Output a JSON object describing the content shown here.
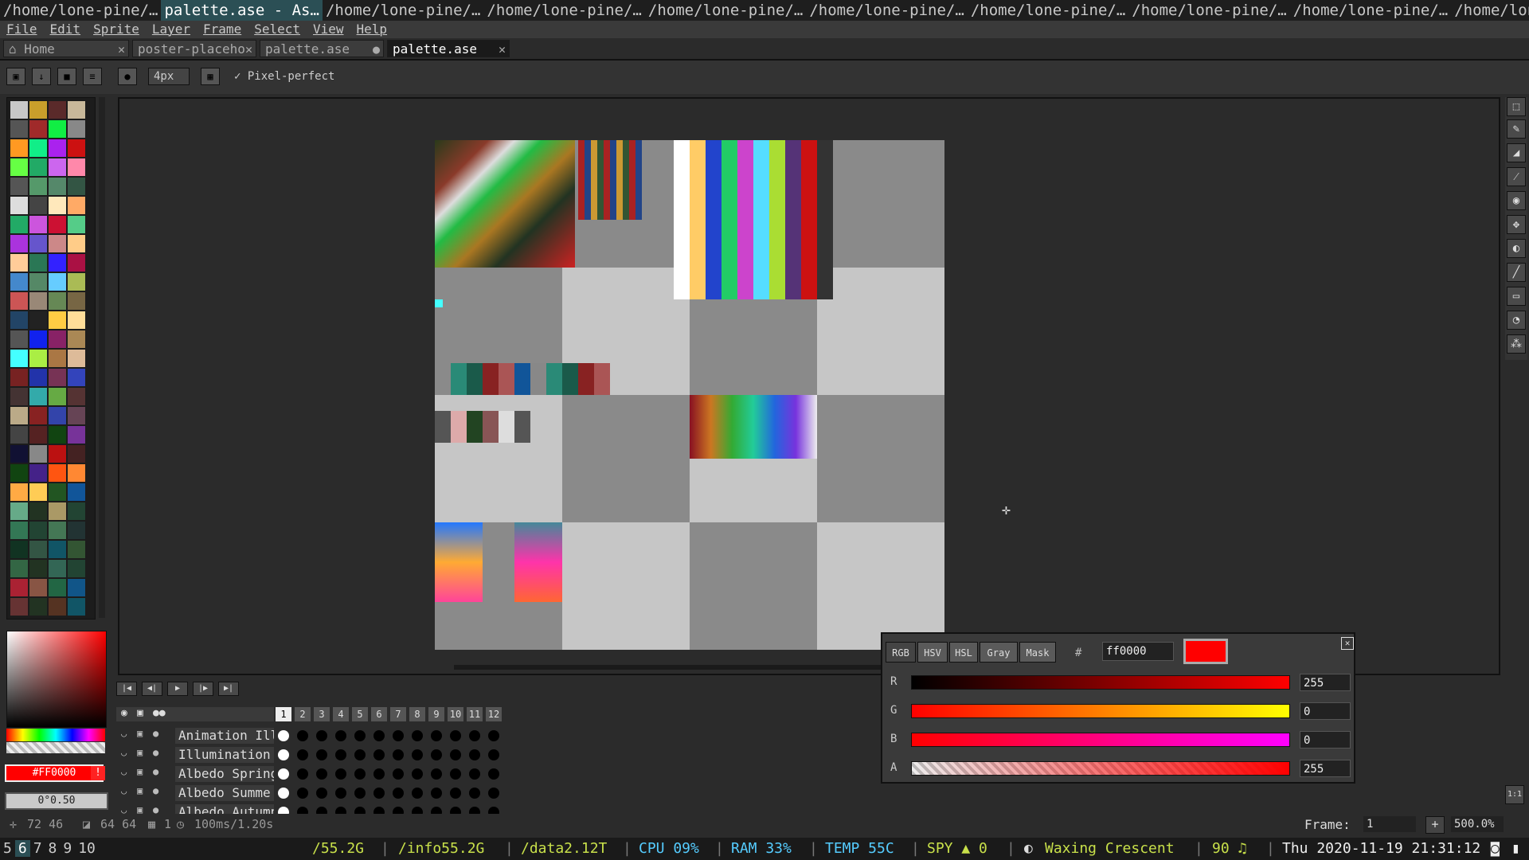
{
  "window_titles": [
    {
      "label": "/home/lone-pine/…",
      "active": false
    },
    {
      "label": "palette.ase - As…",
      "active": true
    },
    {
      "label": "/home/lone-pine/…",
      "active": false
    },
    {
      "label": "/home/lone-pine/…",
      "active": false
    },
    {
      "label": "/home/lone-pine/…",
      "active": false
    },
    {
      "label": "/home/lone-pine/…",
      "active": false
    },
    {
      "label": "/home/lone-pine/…",
      "active": false
    },
    {
      "label": "/home/lone-pine/…",
      "active": false
    },
    {
      "label": "/home/lone-pine/…",
      "active": false
    },
    {
      "label": "/home/lone-pine/…",
      "active": false
    }
  ],
  "menu": [
    "File",
    "Edit",
    "Sprite",
    "Layer",
    "Frame",
    "Select",
    "View",
    "Help"
  ],
  "tabs": [
    {
      "label": "Home",
      "close": "✕",
      "active": false
    },
    {
      "label": "poster-placeho",
      "close": "✕",
      "active": false
    },
    {
      "label": "palette.ase",
      "close": "●",
      "active": false
    },
    {
      "label": "palette.ase",
      "close": "✕",
      "active": true
    }
  ],
  "toolbar": {
    "brush_size": "4px",
    "pixel_perfect": "Pixel-perfect"
  },
  "palette_colors": [
    "#c8c8c8",
    "#c99f2b",
    "#5a2a2a",
    "#c8b89a",
    "#555555",
    "#a02a2a",
    "#11ee44",
    "#888888",
    "#ff9922",
    "#11ee88",
    "#aa22ee",
    "#cc1111",
    "#66ff44",
    "#22aa66",
    "#cc66ee",
    "#ff88aa",
    "#555555",
    "#55996a",
    "#55886a",
    "#335544",
    "#dddddd",
    "#444444",
    "#ffe8bb",
    "#ffaa66",
    "#22aa66",
    "#cc55dd",
    "#cc1133",
    "#55cc88",
    "#aa33dd",
    "#6655cc",
    "#cc8888",
    "#ffcc88",
    "#ffcc99",
    "#2a7755",
    "#3322ff",
    "#aa1144",
    "#4488cc",
    "#558866",
    "#66ccff",
    "#aabb55",
    "#cc5555",
    "#998877",
    "#668855",
    "#776644",
    "#224466",
    "#222222",
    "#ffcc44",
    "#ffdd99",
    "#555555",
    "#1122ee",
    "#882266",
    "#aa8855",
    "#44ffff",
    "#aaee44",
    "#aa7744",
    "#ddbb99",
    "#772222",
    "#2233aa",
    "#773355",
    "#3344bb",
    "#443333",
    "#33aaaa",
    "#66aa44",
    "#553333",
    "#bbaa88",
    "#882222",
    "#3344aa",
    "#664455",
    "#444444",
    "#552222",
    "#114411",
    "#773399",
    "#111133",
    "#888888",
    "#bb1111",
    "#442222",
    "#114411",
    "#442288",
    "#ff5511",
    "#ff8833",
    "#ffaa44",
    "#ffcc55",
    "#225522",
    "#115599",
    "#66aa88",
    "#223322",
    "#aa9966",
    "#224433",
    "#337755",
    "#224433",
    "#447755",
    "#223333",
    "#113322",
    "#335544",
    "#115566",
    "#335533",
    "#336644",
    "#223322",
    "#336655",
    "#224433",
    "#aa2233",
    "#885544",
    "#226644",
    "#115588",
    "#663333",
    "#223322",
    "#553322",
    "#115566"
  ],
  "color_fg": "#FF0000",
  "color_bg": "0°0.50",
  "frames": [
    "1",
    "2",
    "3",
    "4",
    "5",
    "6",
    "7",
    "8",
    "9",
    "10",
    "11",
    "12"
  ],
  "layers": [
    {
      "name": "Animation Illum"
    },
    {
      "name": "Illumination"
    },
    {
      "name": "Albedo Spring"
    },
    {
      "name": "Albedo Summe"
    },
    {
      "name": "Albedo Autumn"
    }
  ],
  "color_dialog": {
    "modes": [
      "RGB",
      "HSV",
      "HSL",
      "Gray",
      "Mask"
    ],
    "hex_symbol": "#",
    "hex": "ff0000",
    "swatch": "#ff0000",
    "channels": [
      {
        "label": "R",
        "value": "255"
      },
      {
        "label": "G",
        "value": "0"
      },
      {
        "label": "B",
        "value": "0"
      },
      {
        "label": "A",
        "value": "255"
      }
    ]
  },
  "status": {
    "position": "72 46",
    "size": "64 64",
    "frame": "1",
    "duration": "100ms/1.20s",
    "frame_label": "Frame:",
    "frame_value": "1",
    "zoom": "500.0%"
  },
  "workspaces": [
    "5",
    "6",
    "7",
    "8",
    "9",
    "10"
  ],
  "bottom": {
    "disk1": "/55.2G",
    "disk2": "/info55.2G",
    "disk3": "/data2.12T",
    "cpu": "CPU 09%",
    "ram": "RAM 33%",
    "temp": "TEMP 55C",
    "spy": "SPY ▲ 0",
    "moon": "Waxing Crescent",
    "volume": "90 ♫",
    "datetime": "Thu 2020-11-19 21:31:12"
  }
}
